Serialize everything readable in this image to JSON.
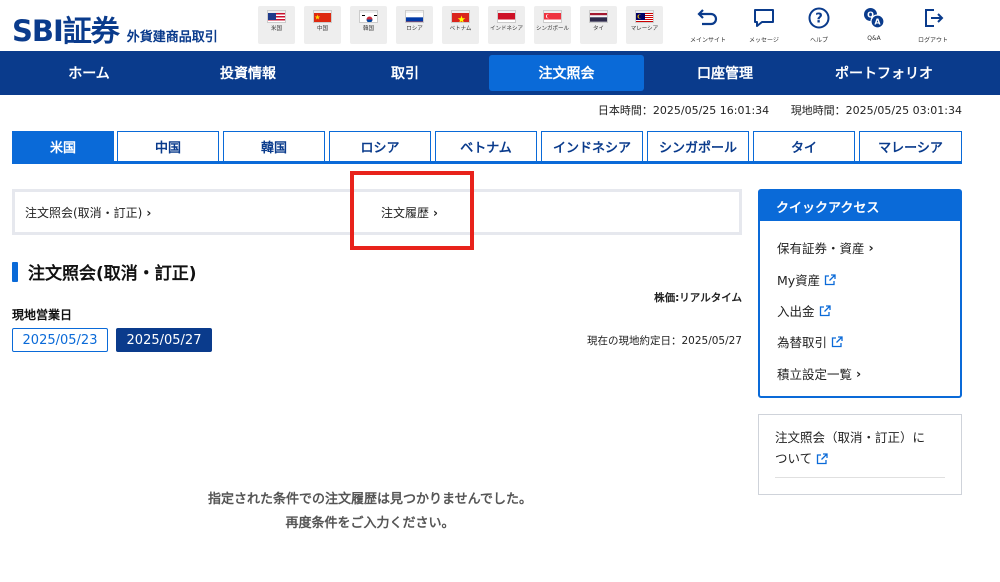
{
  "logo": {
    "main": "SBI証券",
    "sub": "外貨建商品取引"
  },
  "flags": [
    {
      "id": "us",
      "label": "米国"
    },
    {
      "id": "cn",
      "label": "中国"
    },
    {
      "id": "kr",
      "label": "韓国"
    },
    {
      "id": "ru",
      "label": "ロシア"
    },
    {
      "id": "vn",
      "label": "ベトナム"
    },
    {
      "id": "id",
      "label": "インドネシア"
    },
    {
      "id": "sg",
      "label": "シンガポール"
    },
    {
      "id": "th",
      "label": "タイ"
    },
    {
      "id": "my",
      "label": "マレーシア"
    }
  ],
  "utility": [
    {
      "icon": "main-site-icon",
      "label": "メインサイト"
    },
    {
      "icon": "message-icon",
      "label": "メッセージ"
    },
    {
      "icon": "help-icon",
      "label": "ヘルプ"
    },
    {
      "icon": "qa-icon",
      "label": "Q&A"
    },
    {
      "icon": "logout-icon",
      "label": "ログアウト"
    }
  ],
  "nav": [
    {
      "label": "ホーム"
    },
    {
      "label": "投資情報"
    },
    {
      "label": "取引"
    },
    {
      "label": "注文照会",
      "active": true
    },
    {
      "label": "口座管理"
    },
    {
      "label": "ポートフォリオ"
    }
  ],
  "time": {
    "japan": "日本時間：2025/05/25 16:01:34",
    "local": "現地時間：2025/05/25 03:01:34"
  },
  "country_tabs": [
    {
      "label": "米国",
      "active": true
    },
    {
      "label": "中国"
    },
    {
      "label": "韓国"
    },
    {
      "label": "ロシア"
    },
    {
      "label": "ベトナム"
    },
    {
      "label": "インドネシア"
    },
    {
      "label": "シンガポール"
    },
    {
      "label": "タイ"
    },
    {
      "label": "マレーシア"
    }
  ],
  "subnav": {
    "inquiry": "注文照会(取消・訂正)",
    "history": "注文履歴"
  },
  "section": {
    "title": "注文照会(取消・訂正)",
    "price_note": "株価:リアルタイム",
    "bizday_label": "現地営業日",
    "dates": [
      "2025/05/23",
      "2025/05/27"
    ],
    "settle_note": "現在の現地約定日：2025/05/27",
    "empty_line1": "指定された条件での注文履歴は見つかりませんでした。",
    "empty_line2": "再度条件をご入力ください。"
  },
  "quick_access": {
    "title": "クイックアクセス",
    "items": [
      {
        "label": "保有証券・資産",
        "icon": "chevron-right-icon"
      },
      {
        "label": "My資産",
        "icon": "external-link-icon"
      },
      {
        "label": "入出金",
        "icon": "external-link-icon"
      },
      {
        "label": "為替取引",
        "icon": "external-link-icon"
      },
      {
        "label": "積立設定一覧",
        "icon": "chevron-right-icon"
      }
    ]
  },
  "about": {
    "line1": "注文照会（取消・訂正）に",
    "line2": "ついて"
  },
  "colors": {
    "navy": "#0a3b8c",
    "blue": "#0a6ad8",
    "highlight": "#e8221b"
  }
}
